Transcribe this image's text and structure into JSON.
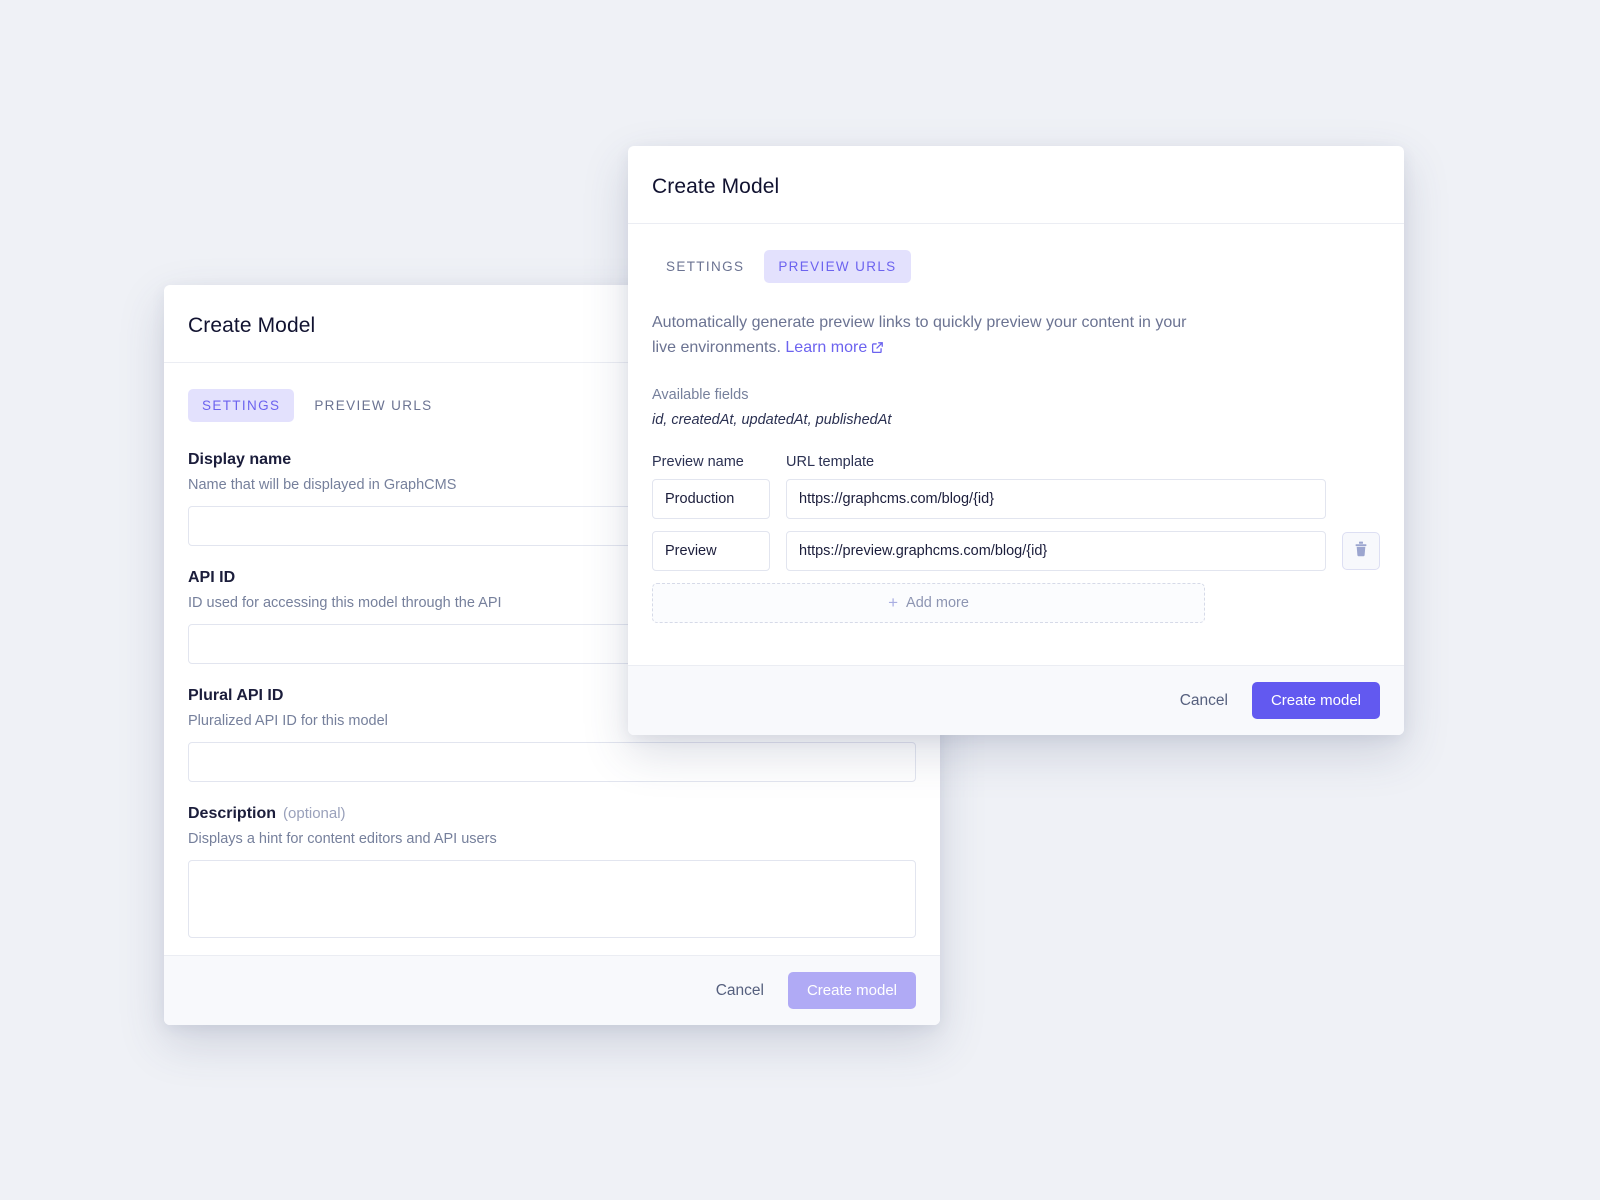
{
  "theme": {
    "background": "#eff1f6",
    "accent": "#6259f0",
    "accent_soft": "#e3e1fd",
    "accent_text": "#6c63ef",
    "accent_disabled": "#b0aaf5",
    "surface": "#ffffff",
    "footer_surface": "#f8f9fc"
  },
  "settings_dialog": {
    "title": "Create Model",
    "tabs": [
      {
        "label": "SETTINGS",
        "active": true
      },
      {
        "label": "PREVIEW URLS",
        "active": false
      }
    ],
    "fields": [
      {
        "label": "Display name",
        "optional": "",
        "hint": "Name that will be displayed in GraphCMS",
        "value": "",
        "placeholder": ""
      },
      {
        "label": "API ID",
        "optional": "",
        "hint": "ID used for accessing this model through the API",
        "value": "",
        "placeholder": ""
      },
      {
        "label": "Plural API ID",
        "optional": "",
        "hint": "Pluralized API ID for this model",
        "value": "",
        "placeholder": ""
      },
      {
        "label": "Description",
        "optional": "(optional)",
        "hint": "Displays a hint for content editors and API users",
        "value": "",
        "placeholder": ""
      }
    ],
    "footer": {
      "cancel_label": "Cancel",
      "submit_label": "Create model",
      "submit_disabled": true
    }
  },
  "preview_dialog": {
    "title": "Create Model",
    "tabs": [
      {
        "label": "SETTINGS",
        "active": false
      },
      {
        "label": "PREVIEW URLS",
        "active": true
      }
    ],
    "intro": {
      "text": "Automatically generate preview links to quickly preview your content in your live environments.",
      "link_label": "Learn more",
      "link_icon": "external-link-icon"
    },
    "available_fields": {
      "label": "Available fields",
      "value": "id, createdAt, updatedAt, publishedAt"
    },
    "table": {
      "headers": {
        "name": "Preview name",
        "url": "URL template"
      },
      "rows": [
        {
          "name": "Production",
          "url": "https://graphcms.com/blog/{id}",
          "deletable": false
        },
        {
          "name": "Preview",
          "url": "https://preview.graphcms.com/blog/{id}",
          "deletable": true
        }
      ],
      "add_more_label": "Add more",
      "add_more_icon": "plus-icon",
      "delete_icon": "trash-icon"
    },
    "footer": {
      "cancel_label": "Cancel",
      "submit_label": "Create model",
      "submit_disabled": false
    }
  }
}
